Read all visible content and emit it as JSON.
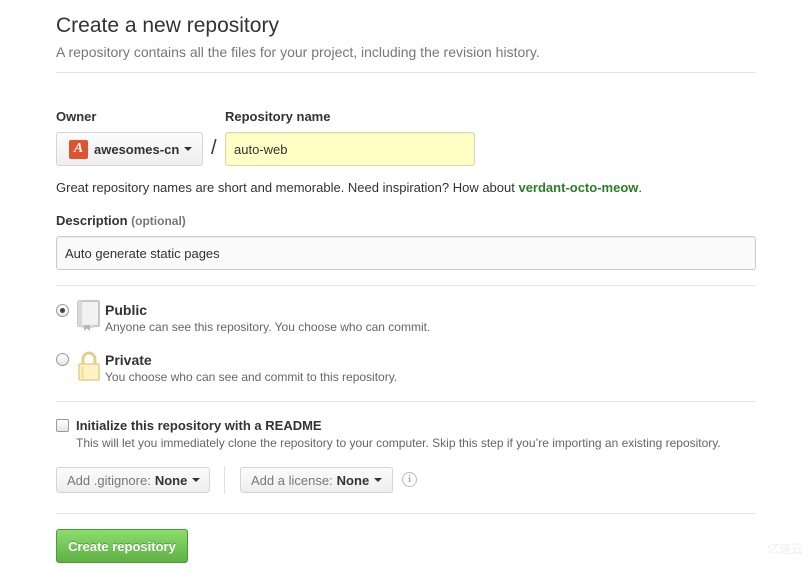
{
  "header": {
    "title": "Create a new repository",
    "subtitle": "A repository contains all the files for your project, including the revision history."
  },
  "owner": {
    "label": "Owner",
    "name": "awesomes-cn",
    "avatar_letter": "A",
    "avatar_color": "#e0532f"
  },
  "separator": "/",
  "repository": {
    "label": "Repository name",
    "value": "auto-web"
  },
  "hint": {
    "text": "Great repository names are short and memorable. Need inspiration? How about ",
    "suggestion": "verdant-octo-meow",
    "end": "."
  },
  "description": {
    "label": "Description",
    "optional": "(optional)",
    "value": "Auto generate static pages"
  },
  "visibility": {
    "selected": "public",
    "public": {
      "title": "Public",
      "desc": "Anyone can see this repository. You choose who can commit."
    },
    "private": {
      "title": "Private",
      "desc": "You choose who can see and commit to this repository."
    }
  },
  "readme": {
    "checked": false,
    "title": "Initialize this repository with a README",
    "desc": "This will let you immediately clone the repository to your computer. Skip this step if you’re importing an existing repository."
  },
  "gitignore": {
    "label": "Add .gitignore:",
    "value": "None"
  },
  "license": {
    "label": "Add a license:",
    "value": "None"
  },
  "info_icon": "i",
  "submit": {
    "label": "Create repository",
    "color": "#60b044"
  },
  "watermark": "亿速云"
}
